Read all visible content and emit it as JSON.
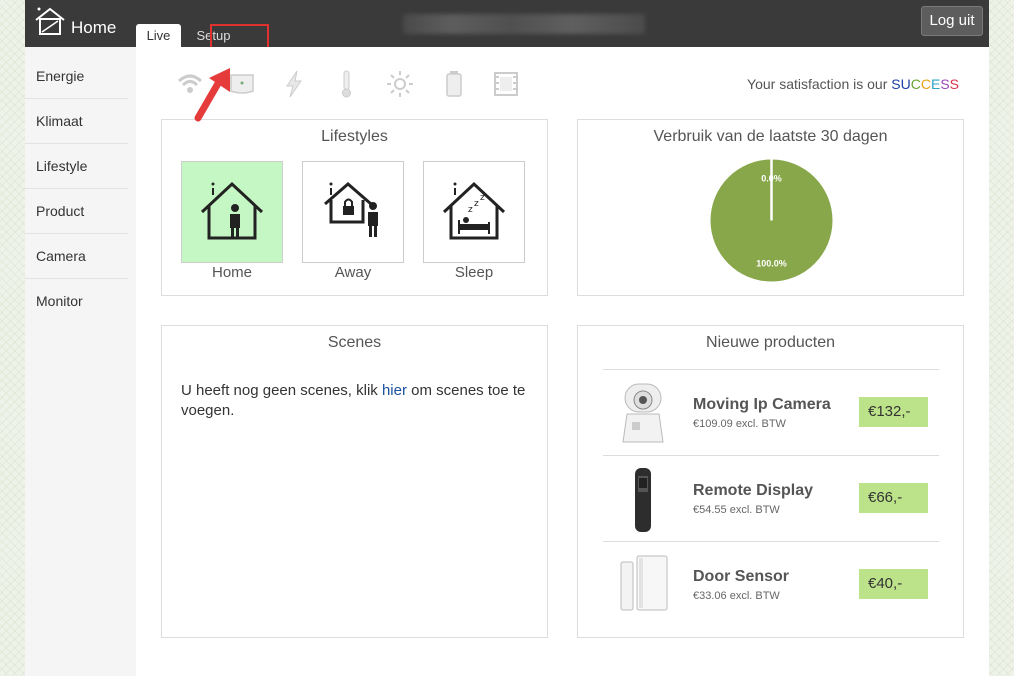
{
  "header": {
    "title": "Home",
    "logout_label": "Log uit"
  },
  "tabs": [
    {
      "label": "Live"
    },
    {
      "label": "Setup"
    }
  ],
  "sidebar": {
    "items": [
      {
        "label": "Energie"
      },
      {
        "label": "Klimaat"
      },
      {
        "label": "Lifestyle"
      },
      {
        "label": "Product"
      },
      {
        "label": "Camera"
      },
      {
        "label": "Monitor"
      }
    ]
  },
  "status_icons": [
    "wifi-icon",
    "router-icon",
    "lightning-icon",
    "thermometer-icon",
    "sun-icon",
    "battery-icon",
    "film-icon"
  ],
  "satisfaction": {
    "prefix": "Your satisfaction is our ",
    "letters": [
      {
        "char": "S",
        "color": "#1f3fa8"
      },
      {
        "char": "U",
        "color": "#1f3fa8"
      },
      {
        "char": "C",
        "color": "#6aa431"
      },
      {
        "char": "C",
        "color": "#e8a21a"
      },
      {
        "char": "E",
        "color": "#2ba6c8"
      },
      {
        "char": "S",
        "color": "#9a48b8"
      },
      {
        "char": "S",
        "color": "#d8344b"
      }
    ]
  },
  "lifestyles": {
    "title": "Lifestyles",
    "items": [
      {
        "label": "Home",
        "active": true
      },
      {
        "label": "Away",
        "active": false
      },
      {
        "label": "Sleep",
        "active": false
      }
    ]
  },
  "usage": {
    "title": "Verbruik van de laatste 30 dagen",
    "chart_data": {
      "type": "pie",
      "values": [
        0.0,
        100.0
      ],
      "labels": [
        "0.0%",
        "100.0%"
      ],
      "colors": [
        "#ffffff",
        "#88a64a"
      ]
    }
  },
  "scenes": {
    "title": "Scenes",
    "text_before": "U heeft nog geen scenes, klik ",
    "link": "hier",
    "text_after": " om scenes toe te voegen."
  },
  "products": {
    "title": "Nieuwe producten",
    "items": [
      {
        "name": "Moving Ip Camera",
        "sub": "€109.09 excl. BTW",
        "price": "€132,-"
      },
      {
        "name": "Remote Display",
        "sub": "€54.55 excl. BTW",
        "price": "€66,-"
      },
      {
        "name": "Door Sensor",
        "sub": "€33.06 excl. BTW",
        "price": "€40,-"
      }
    ]
  },
  "colors": {
    "topbar": "#3a3a3a",
    "active_lifestyle": "#c5f7c5",
    "price_bg": "#bde38a",
    "pie": "#88a64a",
    "highlight": "#e03030"
  }
}
